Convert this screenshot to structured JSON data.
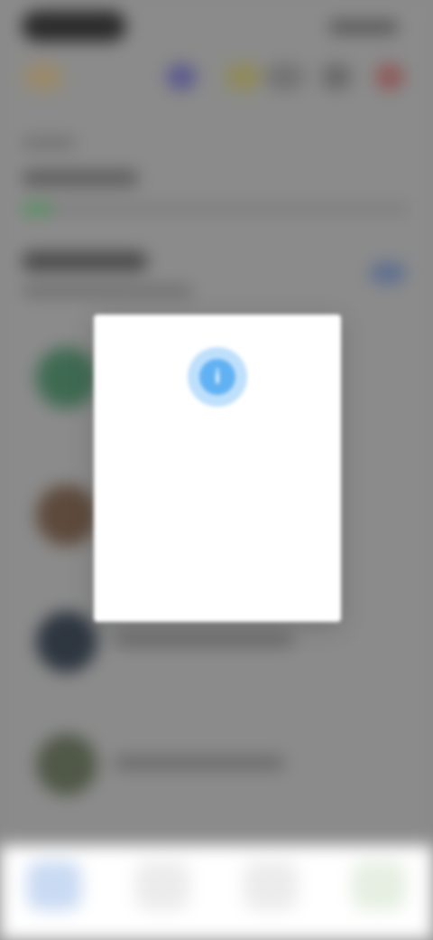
{
  "status_bar": {
    "time": "",
    "indicators": ""
  },
  "progress": {
    "value": 0.08,
    "fill_color": "#4f8f5a"
  },
  "list": {
    "rows": [
      {
        "avatar_color": "#3f6a52"
      },
      {
        "avatar_color": "#5d4a3c"
      },
      {
        "avatar_color": "#2e3640"
      },
      {
        "avatar_color": "#505848"
      }
    ]
  },
  "tabbar": {
    "tabs": [
      {
        "icon": "home-icon",
        "label": ""
      },
      {
        "icon": "list-icon",
        "label": ""
      },
      {
        "icon": "chart-icon",
        "label": ""
      },
      {
        "icon": "profile-icon",
        "label": ""
      }
    ]
  },
  "dialog": {
    "icon": "info-icon",
    "icon_glyph": "i",
    "title": "",
    "body": "",
    "button_label": "",
    "accent": "#3f8fe6"
  }
}
